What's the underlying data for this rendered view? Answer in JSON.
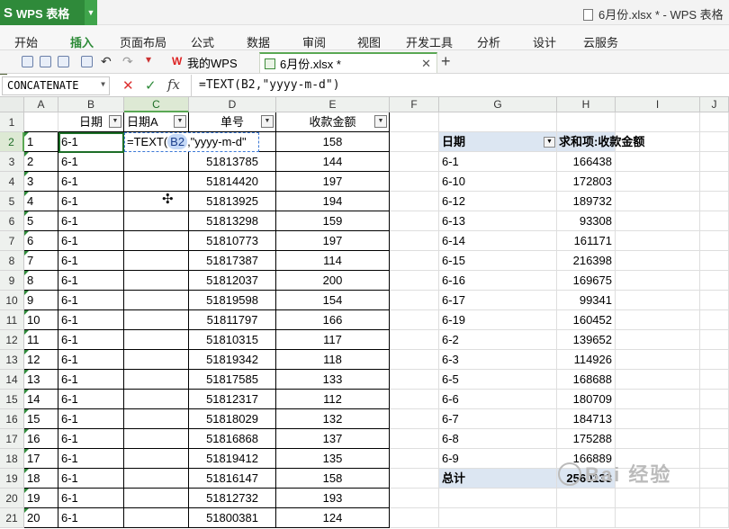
{
  "app": {
    "logo": "S",
    "name": "WPS 表格"
  },
  "window_title": "6月份.xlsx * - WPS 表格",
  "menu": [
    "开始",
    "插入",
    "页面布局",
    "公式",
    "数据",
    "审阅",
    "视图",
    "开发工具",
    "分析",
    "设计",
    "云服务"
  ],
  "menu_active_index": 1,
  "tabs": [
    {
      "label": "我的WPS"
    },
    {
      "label": "6月份.xlsx *"
    }
  ],
  "namebox": "CONCATENATE",
  "formula_buttons": {
    "cancel": "✕",
    "enter": "✓",
    "fx": "fx"
  },
  "formula": "=TEXT(B2,\"yyyy-m-d\")",
  "columns": [
    "A",
    "B",
    "C",
    "D",
    "E",
    "F",
    "G",
    "H",
    "I",
    "J"
  ],
  "row_numbers": [
    1,
    2,
    3,
    4,
    5,
    6,
    7,
    8,
    9,
    10,
    11,
    12,
    13,
    14,
    15,
    16,
    17,
    18,
    19,
    20,
    21
  ],
  "table_headers": {
    "B": "日期",
    "C": "日期A",
    "D": "单号",
    "E": "收款金额"
  },
  "table_rows": [
    {
      "a": "1",
      "b": "6-1",
      "d": "",
      "e": "158"
    },
    {
      "a": "2",
      "b": "6-1",
      "d": "51813785",
      "e": "144"
    },
    {
      "a": "3",
      "b": "6-1",
      "d": "51814420",
      "e": "197"
    },
    {
      "a": "4",
      "b": "6-1",
      "d": "51813925",
      "e": "194"
    },
    {
      "a": "5",
      "b": "6-1",
      "d": "51813298",
      "e": "159"
    },
    {
      "a": "6",
      "b": "6-1",
      "d": "51810773",
      "e": "197"
    },
    {
      "a": "7",
      "b": "6-1",
      "d": "51817387",
      "e": "114"
    },
    {
      "a": "8",
      "b": "6-1",
      "d": "51812037",
      "e": "200"
    },
    {
      "a": "9",
      "b": "6-1",
      "d": "51819598",
      "e": "154"
    },
    {
      "a": "10",
      "b": "6-1",
      "d": "51811797",
      "e": "166"
    },
    {
      "a": "11",
      "b": "6-1",
      "d": "51810315",
      "e": "117"
    },
    {
      "a": "12",
      "b": "6-1",
      "d": "51819342",
      "e": "118"
    },
    {
      "a": "13",
      "b": "6-1",
      "d": "51817585",
      "e": "133"
    },
    {
      "a": "14",
      "b": "6-1",
      "d": "51812317",
      "e": "112"
    },
    {
      "a": "15",
      "b": "6-1",
      "d": "51818029",
      "e": "132"
    },
    {
      "a": "16",
      "b": "6-1",
      "d": "51816868",
      "e": "137"
    },
    {
      "a": "17",
      "b": "6-1",
      "d": "51819412",
      "e": "135"
    },
    {
      "a": "18",
      "b": "6-1",
      "d": "51816147",
      "e": "158"
    },
    {
      "a": "19",
      "b": "6-1",
      "d": "51812732",
      "e": "193"
    },
    {
      "a": "20",
      "b": "6-1",
      "d": "51800381",
      "e": "124"
    }
  ],
  "editing": {
    "prefix": "=TEXT(",
    "ref": "B2",
    "suffix": ",\"yyyy-m-d\""
  },
  "pivot": {
    "header_date": "日期",
    "header_sum": "求和项:收款金额",
    "rows": [
      {
        "date": "6-1",
        "sum": "166438"
      },
      {
        "date": "6-10",
        "sum": "172803"
      },
      {
        "date": "6-12",
        "sum": "189732"
      },
      {
        "date": "6-13",
        "sum": "93308"
      },
      {
        "date": "6-14",
        "sum": "161171"
      },
      {
        "date": "6-15",
        "sum": "216398"
      },
      {
        "date": "6-16",
        "sum": "169675"
      },
      {
        "date": "6-17",
        "sum": "99341"
      },
      {
        "date": "6-19",
        "sum": "160452"
      },
      {
        "date": "6-2",
        "sum": "139652"
      },
      {
        "date": "6-3",
        "sum": "114926"
      },
      {
        "date": "6-5",
        "sum": "168688"
      },
      {
        "date": "6-6",
        "sum": "180709"
      },
      {
        "date": "6-7",
        "sum": "184713"
      },
      {
        "date": "6-8",
        "sum": "175288"
      },
      {
        "date": "6-9",
        "sum": "166889"
      }
    ],
    "total_label": "总计",
    "total_value": "2560133"
  },
  "watermark": "Bai 经验",
  "colors": {
    "accent": "#2f8a3a",
    "pivot_fill": "#dce6f2"
  }
}
